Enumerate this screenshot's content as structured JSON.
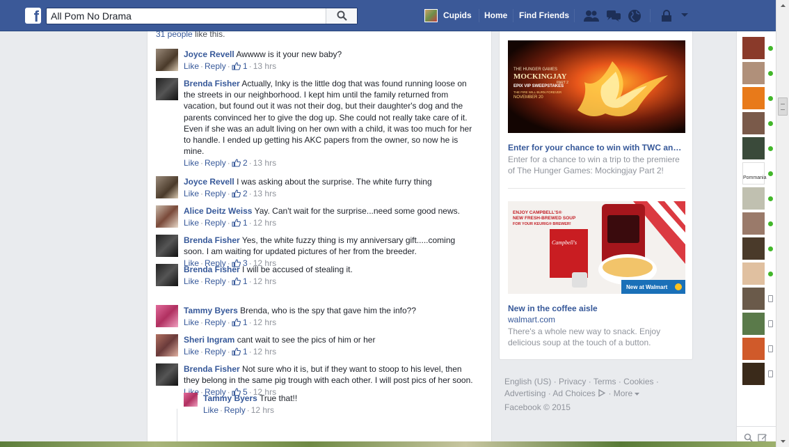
{
  "search": {
    "value": "All Pom No Drama"
  },
  "nav": {
    "profile_name": "Cupids",
    "home": "Home",
    "find_friends": "Find Friends"
  },
  "post": {
    "likes_count": "31 people",
    "likes_suffix": "like this."
  },
  "comment_actions": {
    "like": "Like",
    "reply": "Reply",
    "sep": "·"
  },
  "comments": [
    {
      "author": "Joyce Revell",
      "text": "Awwww is it your new baby?",
      "likes": "1",
      "time": "13 hrs"
    },
    {
      "author": "Brenda Fisher",
      "text": "Actually, Inky is the little dog that was found running loose on the streets in our neighborhood. I kept him until the family returned from vacation, but found out it was not their dog, but their daughter's dog and the parents convinced her to give the dog up. She could not really take care of it. Even if she was an adult living on her own with a child, it was too much for her to handle. I ended up getting his AKC papers from the owner, so now he is mine.",
      "likes": "2",
      "time": "13 hrs"
    },
    {
      "author": "Joyce Revell",
      "text": "I was asking about the surprise. The white furry thing",
      "likes": "2",
      "time": "13 hrs"
    },
    {
      "author": "Alice Deitz Weiss",
      "text": "Yay. Can't wait for the surprise...need some good news.",
      "likes": "1",
      "time": "12 hrs"
    },
    {
      "author": "Brenda Fisher",
      "text": "Yes, the white fuzzy thing is my anniversary gift.....coming soon. I am waiting for updated pictures of her from the breeder.",
      "likes": "3",
      "time": "12 hrs"
    },
    {
      "author": "Brenda Fisher",
      "text": "I will be accused of stealing it.",
      "likes": "1",
      "time": "12 hrs"
    },
    {
      "author": "Tammy Byers",
      "text": "Brenda, who is the spy that gave him the info??",
      "likes": "1",
      "time": "12 hrs"
    },
    {
      "author": "Sheri Ingram",
      "text": "cant wait to see the pics of him or her",
      "likes": "1",
      "time": "12 hrs"
    },
    {
      "author": "Brenda Fisher",
      "text": "Not sure who it is, but if they want to stoop to his level, then they belong in the same pig trough with each other. I will post pics of her soon.",
      "likes": "5",
      "time": "12 hrs"
    }
  ],
  "reply": {
    "author": "Tammy Byers",
    "text": "True that!!",
    "time": "12 hrs"
  },
  "ads": [
    {
      "image_lines": [
        "THE HUNGER GAMES",
        "MOCKINGJAY",
        "PART 2",
        "EPIX VIP SWEEPSTAKES",
        "THE FIRE WILL BURN FOREVER",
        "NOVEMBER 20"
      ],
      "title": "Enter for your chance to win with TWC and…",
      "text": "Enter for a chance to win a trip to the premiere of The Hunger Games: Mockingjay Part 2!"
    },
    {
      "image_lines": [
        "ENJOY CAMPBELL'S®",
        "NEW FRESH-BREWED SOUP",
        "FOR YOUR KEURIG® BREWER!",
        "Campbell's",
        "New at Walmart"
      ],
      "title": "New in the coffee aisle",
      "url": "walmart.com",
      "text": "There's a whole new way to snack. Enjoy delicious soup at the touch of a button."
    }
  ],
  "footer": {
    "links": [
      "English (US)",
      "Privacy",
      "Terms",
      "Cookies",
      "Advertising",
      "Ad Choices",
      "More"
    ],
    "copyright": "Facebook © 2015"
  },
  "chat": {
    "avatar_label": "Pommania",
    "online": [
      true,
      true,
      true,
      true,
      true,
      true,
      true,
      true,
      true,
      true,
      false,
      false,
      false,
      false
    ]
  },
  "colors": {
    "brand": "#3b5998",
    "link": "#365899",
    "online": "#42b72a"
  }
}
